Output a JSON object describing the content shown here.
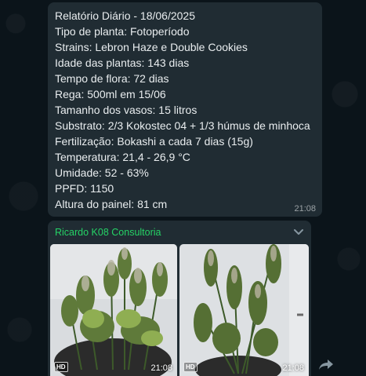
{
  "messages": [
    {
      "lines": [
        "Relatório Diário - 18/06/2025",
        "Tipo de planta: Fotoperíodo",
        "Strains: Lebron Haze e Double Cookies",
        "Idade das plantas: 143 dias",
        "Tempo de flora: 72 dias",
        "Rega: 500ml em 15/06",
        "Tamanho dos vasos: 15 litros",
        "Substrato: 2/3 Kokostec 04 + 1/3 húmus de minhoca",
        "Fertilização: Bokashi a cada 7 dias (15g)",
        "Temperatura: 21,4 - 26,9 °C",
        "Umidade: 52 - 63%",
        "PPFD: 1150",
        "Altura do painel: 81 cm"
      ],
      "time": "21:08"
    },
    {
      "sender": "Ricardo K08 Consultoria",
      "sender_color": "#25d366",
      "photos": [
        {
          "badge": "HD",
          "time": "21:08"
        },
        {
          "badge": "HD",
          "time": "21:08"
        }
      ],
      "icons": [
        "chevron-down-icon",
        "forward-icon"
      ]
    }
  ]
}
